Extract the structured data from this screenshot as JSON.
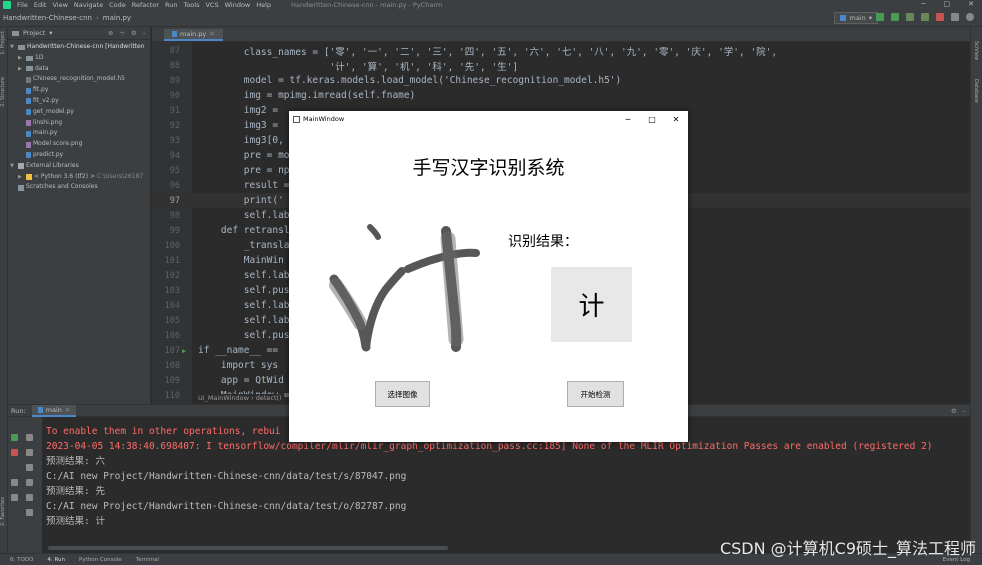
{
  "ide": {
    "menu": [
      "File",
      "Edit",
      "View",
      "Navigate",
      "Code",
      "Refactor",
      "Run",
      "Tools",
      "VCS",
      "Window",
      "Help"
    ],
    "window_title": "Handwritten-Chinese-cnn - main.py - PyCharm",
    "breadcrumb": [
      "Handwritten-Chinese-cnn",
      "main.py"
    ],
    "run_config": "main",
    "left_stripe": [
      "1: Project",
      "2: Structure",
      "2: Favorites"
    ],
    "right_stripe": [
      "SciView",
      "Database"
    ]
  },
  "project": {
    "header": "Project",
    "root": "Handwritten-Chinese-cnn [Handwritten",
    "items": [
      {
        "name": "1D",
        "kind": "folder"
      },
      {
        "name": "data",
        "kind": "folder"
      },
      {
        "name": "Chinese_recognition_model.h5",
        "kind": "h5"
      },
      {
        "name": "fit.py",
        "kind": "py"
      },
      {
        "name": "fit_v2.py",
        "kind": "py"
      },
      {
        "name": "get_model.py",
        "kind": "py"
      },
      {
        "name": "linshi.png",
        "kind": "img"
      },
      {
        "name": "main.py",
        "kind": "py"
      },
      {
        "name": "Model score.png",
        "kind": "img"
      },
      {
        "name": "predict.py",
        "kind": "py"
      }
    ],
    "external": "External Libraries",
    "python": "< Python 3.6 (tf2) >",
    "python_path": "C:\\Users\\26187",
    "scratches": "Scratches and Consoles"
  },
  "editor": {
    "tab": "main.py",
    "breadcrumb": [
      "Ui_MainWindow",
      "detect()"
    ],
    "lines": [
      {
        "n": "87",
        "code": "        class_names = ['零', '一', '二', '三', '四', '五', '六', '七', '八', '九', '零', '庆', '学', '院',"
      },
      {
        "n": "88",
        "code": "                       '计', '算', '机', '科', '先', '生']"
      },
      {
        "n": "89",
        "code": "        model = tf.keras.models.load_model('Chinese_recognition_model.h5')"
      },
      {
        "n": "90",
        "code": "        img = mpimg.imread(self.fname)"
      },
      {
        "n": "91",
        "code": "        img2 ="
      },
      {
        "n": "92",
        "code": "        img3 ="
      },
      {
        "n": "93",
        "code": "        img3[0,"
      },
      {
        "n": "94",
        "code": "        pre = mo"
      },
      {
        "n": "95",
        "code": "        pre = np"
      },
      {
        "n": "96",
        "code": "        result ="
      },
      {
        "n": "97",
        "code": "        print('"
      },
      {
        "n": "98",
        "code": "        self.lab"
      },
      {
        "n": "99",
        "code": "    def retransl"
      },
      {
        "n": "100",
        "code": "        _transla"
      },
      {
        "n": "101",
        "code": "        MainWin"
      },
      {
        "n": "102",
        "code": "        self.lab"
      },
      {
        "n": "103",
        "code": "        self.pus"
      },
      {
        "n": "104",
        "code": "        self.lab"
      },
      {
        "n": "105",
        "code": "        self.lab"
      },
      {
        "n": "106",
        "code": "        self.pus"
      },
      {
        "n": "107",
        "code": "if __name__ =="
      },
      {
        "n": "108",
        "code": "    import sys"
      },
      {
        "n": "109",
        "code": "    app = QtWid"
      },
      {
        "n": "110",
        "code": "    MainWindow ="
      }
    ]
  },
  "run": {
    "label": "Run:",
    "tab": "main",
    "console": [
      {
        "type": "err",
        "text": "To enable them in other operations, rebui"
      },
      {
        "type": "err",
        "text": "2023-04-05 14:38:40.698407: I tensorflow/compiler/mlir/mlir_graph_optimization_pass.cc:185] None of the MLIR Optimization Passes are enabled (registered 2)"
      },
      {
        "type": "out",
        "text": "预测结果: 六"
      },
      {
        "type": "out",
        "text": "C:/AI new Project/Handwritten-Chinese-cnn/data/test/s/87047.png"
      },
      {
        "type": "out",
        "text": "预测结果: 先"
      },
      {
        "type": "out",
        "text": "C:/AI new Project/Handwritten-Chinese-cnn/data/test/o/82787.png"
      },
      {
        "type": "out",
        "text": "预测结果: 计"
      }
    ]
  },
  "statusbar": {
    "items": [
      "6: TODO",
      "4: Run",
      "Python Console",
      "Terminal"
    ],
    "right": "Event Log"
  },
  "app_window": {
    "title": "MainWindow",
    "heading": "手写汉字识别系统",
    "result_label": "识别结果：",
    "result_value": "计",
    "select_button": "选择图像",
    "start_button": "开始检测"
  },
  "watermark": "CSDN @计算机C9硕士_算法工程师",
  "colors": {
    "ide_bg": "#2b2b2b",
    "panel_bg": "#3c3f41",
    "error_text": "#ff6b68",
    "string": "#6a8759",
    "accent": "#4a88c7"
  }
}
